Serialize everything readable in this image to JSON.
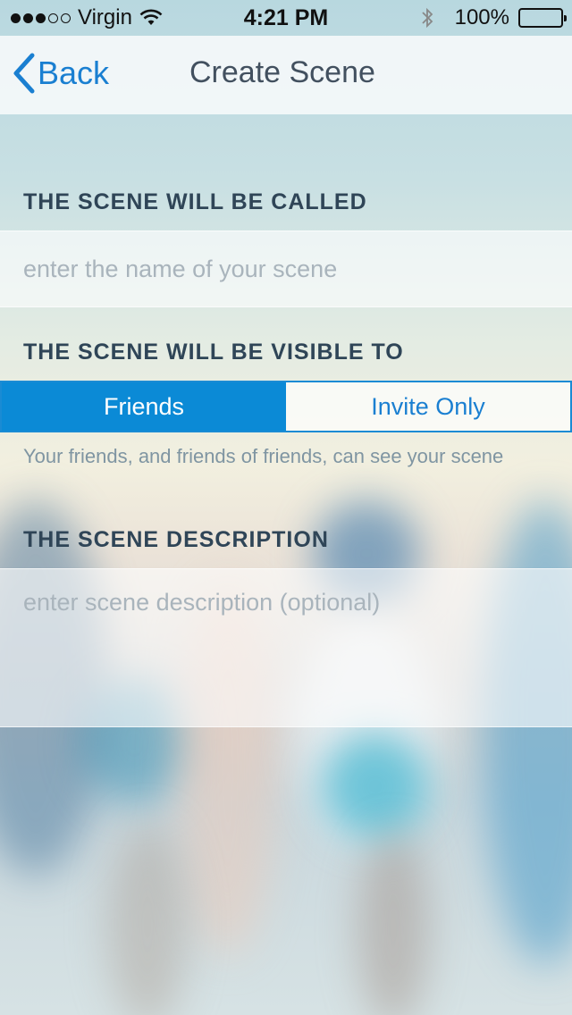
{
  "status_bar": {
    "carrier": "Virgin",
    "signal_bars": 3,
    "signal_max": 5,
    "time": "4:21 PM",
    "battery": "100%"
  },
  "nav": {
    "back_label": "Back",
    "title": "Create Scene"
  },
  "form": {
    "name_section_label": "THE SCENE WILL BE CALLED",
    "name_placeholder": "enter the name of your scene",
    "visibility_section_label": "THE SCENE WILL BE VISIBLE TO",
    "visibility_options": [
      "Friends",
      "Invite Only"
    ],
    "visibility_selected": "Friends",
    "visibility_hint": "Your friends, and friends of friends, can see your scene",
    "description_section_label": "THE SCENE DESCRIPTION",
    "description_placeholder": "enter scene description (optional)"
  },
  "colors": {
    "accent": "#0b8ad6",
    "section_text": "#2f4557",
    "placeholder": "#a9b4bc"
  }
}
